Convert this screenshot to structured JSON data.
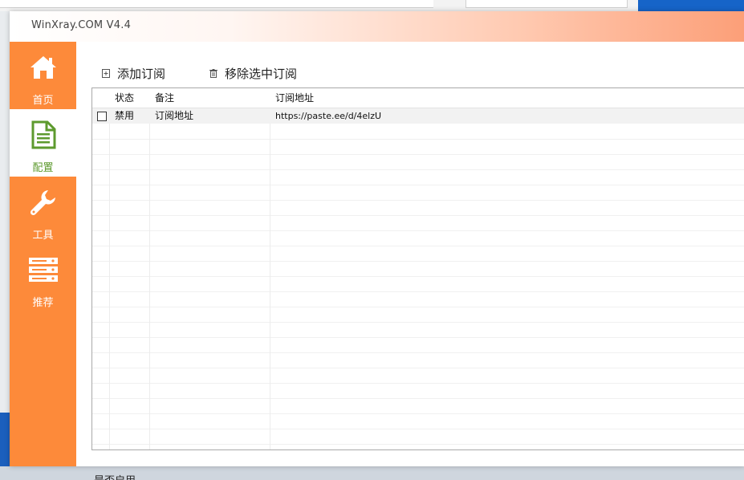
{
  "window": {
    "title": "WinXray.COM   V4.4"
  },
  "sidebar": {
    "items": [
      {
        "label": "首页",
        "icon": "home-icon"
      },
      {
        "label": "配置",
        "icon": "document-icon"
      },
      {
        "label": "工具",
        "icon": "wrench-icon"
      },
      {
        "label": "推荐",
        "icon": "server-icon"
      }
    ],
    "active_index": 1
  },
  "toolbar": {
    "add_label": "添加订阅",
    "remove_label": "移除选中订阅"
  },
  "table": {
    "columns": [
      "状态",
      "备注",
      "订阅地址"
    ],
    "rows": [
      {
        "checked": false,
        "status": "禁用",
        "remark": "订阅地址",
        "url": "https://paste.ee/d/4elzU"
      }
    ]
  },
  "bottom": {
    "partial_text": "是否启用"
  },
  "colors": {
    "accent": "#fd8a3a",
    "active_icon": "#5d9a2e"
  }
}
